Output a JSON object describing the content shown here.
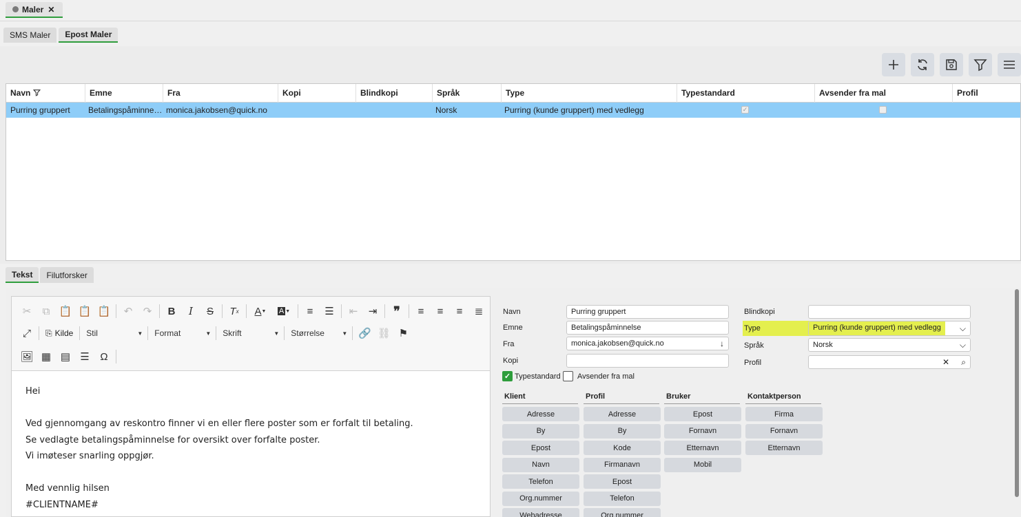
{
  "doc_tab": {
    "label": "Maler",
    "close": "✕"
  },
  "sub_tabs": [
    {
      "label": "SMS Maler"
    },
    {
      "label": "Epost Maler"
    }
  ],
  "grid": {
    "columns": [
      "Navn",
      "Emne",
      "Fra",
      "Kopi",
      "Blindkopi",
      "Språk",
      "Type",
      "Typestandard",
      "Avsender fra mal",
      "Profil"
    ],
    "rows": [
      {
        "navn": "Purring gruppert",
        "emne": "Betalingspåminnelse",
        "fra": "monica.jakobsen@quick.no",
        "kopi": "",
        "blindkopi": "",
        "sprak": "Norsk",
        "type": "Purring (kunde gruppert) med vedlegg",
        "typestandard": true,
        "avsender": false,
        "profil": ""
      }
    ]
  },
  "bottom_tabs": [
    {
      "label": "Tekst"
    },
    {
      "label": "Filutforsker"
    }
  ],
  "editor": {
    "kilde_label": "Kilde",
    "combos": {
      "stil": "Stil",
      "format": "Format",
      "skrift": "Skrift",
      "storrelse": "Størrelse"
    },
    "lines": [
      "Hei",
      "",
      "Ved gjennomgang av reskontro finner vi en eller flere poster som er forfalt til betaling.",
      "Se vedlagte betalingspåminnelse for oversikt over forfalte poster.",
      "Vi imøteser snarling oppgjør.",
      "",
      "Med vennlig hilsen",
      "#CLIENTNAME#"
    ]
  },
  "form": {
    "navn_label": "Navn",
    "navn_value": "Purring gruppert",
    "emne_label": "Emne",
    "emne_value": "Betalingspåminnelse",
    "fra_label": "Fra",
    "fra_value": "monica.jakobsen@quick.no",
    "kopi_label": "Kopi",
    "kopi_value": "",
    "blindkopi_label": "Blindkopi",
    "blindkopi_value": "",
    "type_label": "Type",
    "type_value": "Purring (kunde gruppert) med vedlegg",
    "sprak_label": "Språk",
    "sprak_value": "Norsk",
    "profil_label": "Profil",
    "profil_value": "",
    "typestandard_label": "Typestandard",
    "typestandard_checked": true,
    "avsender_label": "Avsender fra mal",
    "avsender_checked": false
  },
  "merge_fields": {
    "klient": {
      "title": "Klient",
      "items": [
        "Adresse",
        "By",
        "Epost",
        "Navn",
        "Telefon",
        "Org.nummer",
        "Webadresse"
      ]
    },
    "profil": {
      "title": "Profil",
      "items": [
        "Adresse",
        "By",
        "Kode",
        "Firmanavn",
        "Epost",
        "Telefon",
        "Org.nummer"
      ]
    },
    "bruker": {
      "title": "Bruker",
      "items": [
        "Epost",
        "Fornavn",
        "Etternavn",
        "Mobil"
      ]
    },
    "kontaktperson": {
      "title": "Kontaktperson",
      "items": [
        "Firma",
        "Fornavn",
        "Etternavn"
      ]
    }
  },
  "colors": {
    "accent": "#2e9d3c",
    "selection": "#8ecdf8",
    "highlight": "#e4ef4e"
  }
}
